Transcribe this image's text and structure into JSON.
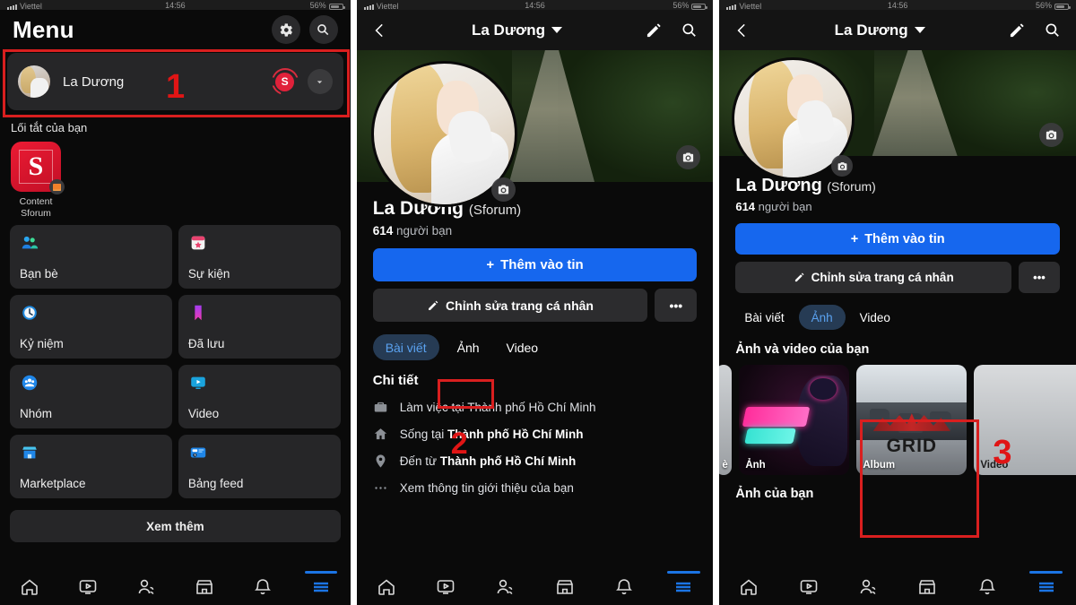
{
  "status_bar": {
    "carrier": "Viettel",
    "time": "14:56",
    "battery": "56%"
  },
  "panel1": {
    "title": "Menu",
    "icons": {
      "settings": "gear-icon",
      "search": "search-icon"
    },
    "account": {
      "name": "La Dương",
      "switch_badge": "S",
      "expand": "chevron-down-icon"
    },
    "shortcuts_label": "Lối tắt của bạn",
    "shortcut": {
      "name": "Content Sforum",
      "logo": "S"
    },
    "grid": [
      {
        "label": "Bạn bè",
        "icon": "friends-icon"
      },
      {
        "label": "Sự kiện",
        "icon": "events-calendar-icon"
      },
      {
        "label": "Kỷ niệm",
        "icon": "memories-clock-icon"
      },
      {
        "label": "Đã lưu",
        "icon": "saved-bookmark-icon"
      },
      {
        "label": "Nhóm",
        "icon": "groups-icon"
      },
      {
        "label": "Video",
        "icon": "video-icon"
      },
      {
        "label": "Marketplace",
        "icon": "marketplace-icon"
      },
      {
        "label": "Bảng feed",
        "icon": "feeds-icon"
      }
    ],
    "see_more": "Xem thêm"
  },
  "panel2": {
    "header": {
      "back": "back-icon",
      "title": "La Dương",
      "edit": "pencil-icon",
      "search": "search-icon"
    },
    "profile": {
      "name": "La Dương",
      "suffix": "(Sforum)",
      "friends_count": "614",
      "friends_label": "người bạn"
    },
    "buttons": {
      "add_story": "Thêm vào tin",
      "edit_profile": "Chỉnh sửa trang cá nhân",
      "more": "•••"
    },
    "tabs": [
      {
        "label": "Bài viết",
        "selected": true
      },
      {
        "label": "Ảnh",
        "selected": false
      },
      {
        "label": "Video",
        "selected": false
      }
    ],
    "details_title": "Chi tiết",
    "details": [
      {
        "icon": "briefcase-icon",
        "prefix": "Làm việc tại ",
        "place": "Thành phố Hồ Chí Minh",
        "bold": false
      },
      {
        "icon": "home-icon",
        "prefix": "Sống tại ",
        "place": "Thành phố Hồ Chí Minh",
        "bold": true
      },
      {
        "icon": "location-pin-icon",
        "prefix": "Đến từ ",
        "place": "Thành phố Hồ Chí Minh",
        "bold": true
      },
      {
        "icon": "ellipsis-icon",
        "prefix": "Xem thông tin giới thiệu của bạn",
        "place": "",
        "bold": false
      }
    ]
  },
  "panel3": {
    "header": {
      "back": "back-icon",
      "title": "La Dương",
      "edit": "pencil-icon",
      "search": "search-icon"
    },
    "profile": {
      "name": "La Dương",
      "suffix": "(Sforum)",
      "friends_count": "614",
      "friends_label": "người bạn"
    },
    "buttons": {
      "add_story": "Thêm vào tin",
      "edit_profile": "Chỉnh sửa trang cá nhân",
      "more": "•••"
    },
    "tabs": [
      {
        "label": "Bài viết",
        "selected": false
      },
      {
        "label": "Ảnh",
        "selected": true
      },
      {
        "label": "Video",
        "selected": false
      }
    ],
    "media_section_title": "Ảnh và video của bạn",
    "media_items": [
      {
        "caption": "è",
        "type": "edge"
      },
      {
        "caption": "Ảnh",
        "type": "photos"
      },
      {
        "caption": "Album",
        "type": "album"
      },
      {
        "caption": "Video",
        "type": "video"
      }
    ],
    "photos_section_title": "Ảnh của bạn"
  },
  "bottom_nav": [
    {
      "name": "home-icon",
      "active": false
    },
    {
      "name": "video-icon",
      "active": false
    },
    {
      "name": "friends-icon",
      "active": false
    },
    {
      "name": "marketplace-icon",
      "active": false
    },
    {
      "name": "notifications-bell-icon",
      "active": false
    },
    {
      "name": "menu-hamburger-icon",
      "active": true
    }
  ],
  "annotations": [
    {
      "number": "1",
      "target": "account-switcher-row"
    },
    {
      "number": "2",
      "target": "photos-tab"
    },
    {
      "number": "3",
      "target": "album-tile"
    }
  ],
  "colors": {
    "accent_blue": "#1667ee",
    "annotation_red": "#d91f1f",
    "card_bg": "#262628",
    "page_bg": "#0a0a0a"
  }
}
